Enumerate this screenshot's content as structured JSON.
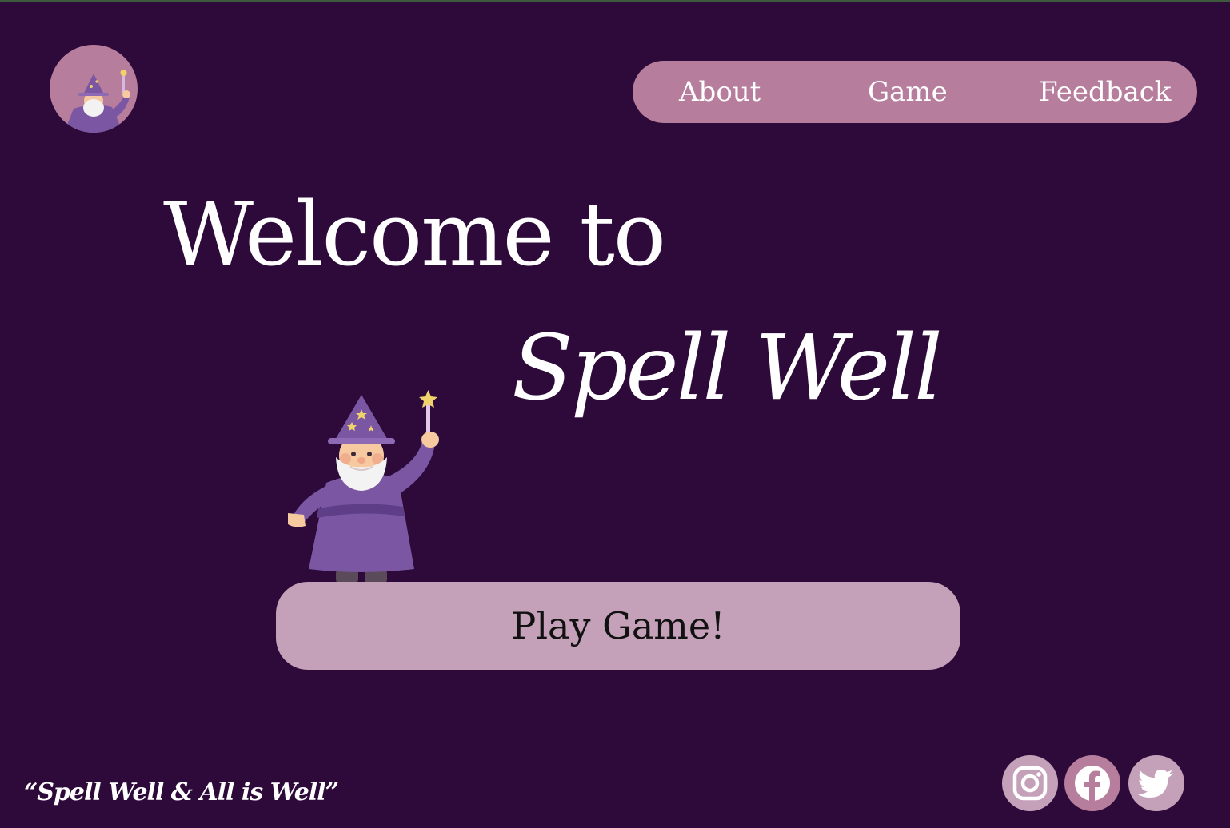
{
  "header": {
    "logo_icon": "wizard-icon",
    "nav": {
      "about": "About",
      "game": "Game",
      "feedback": "Feedback"
    }
  },
  "hero": {
    "line1": "Welcome to",
    "line2": "Spell Well",
    "illustration": "wizard-icon",
    "play_button": "Play Game!"
  },
  "footer": {
    "tagline": "“Spell Well & All is Well”",
    "social": [
      {
        "name": "instagram-icon"
      },
      {
        "name": "facebook-icon"
      },
      {
        "name": "twitter-icon"
      }
    ]
  },
  "colors": {
    "background": "#2d0a3a",
    "nav_pill": "#b77d9c",
    "button": "#c4a0b9",
    "text": "#ffffff"
  }
}
